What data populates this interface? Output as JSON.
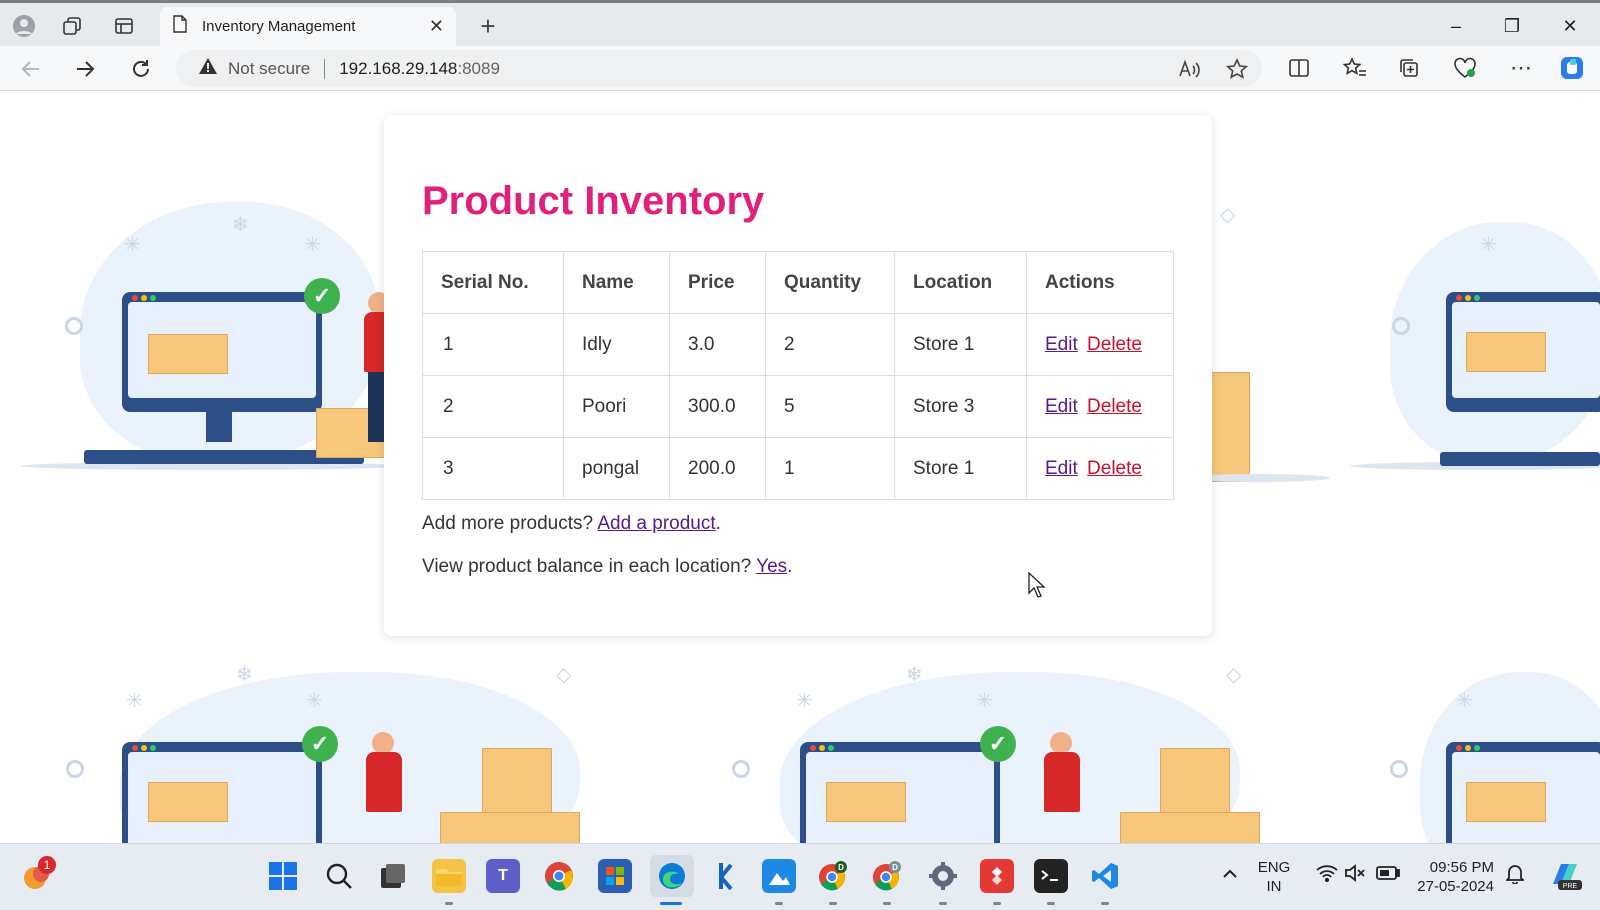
{
  "browser": {
    "tab_title": "Inventory Management",
    "tab_close": "✕",
    "new_tab": "+",
    "security_label": "Not secure",
    "url_host": "192.168.29.148",
    "url_port": ":8089",
    "window_controls": {
      "minimize": "–",
      "restore": "❐",
      "close": "✕"
    }
  },
  "page": {
    "heading": "Product Inventory",
    "table": {
      "headers": {
        "serial": "Serial No.",
        "name": "Name",
        "price": "Price",
        "quantity": "Quantity",
        "location": "Location",
        "actions": "Actions"
      },
      "rows": [
        {
          "serial": "1",
          "name": "Idly",
          "price": "3.0",
          "quantity": "2",
          "location": "Store 1",
          "edit": "Edit",
          "delete": "Delete"
        },
        {
          "serial": "2",
          "name": "Poori",
          "price": "300.0",
          "quantity": "5",
          "location": "Store 3",
          "edit": "Edit",
          "delete": "Delete"
        },
        {
          "serial": "3",
          "name": "pongal",
          "price": "200.0",
          "quantity": "1",
          "location": "Store 1",
          "edit": "Edit",
          "delete": "Delete"
        }
      ]
    },
    "add_more_text": "Add more products?",
    "add_link": "Add a product",
    "view_balance_text": "View product balance in each location?",
    "view_link": "Yes",
    "period": "."
  },
  "taskbar": {
    "notification_count": "1",
    "language_line1": "ENG",
    "language_line2": "IN",
    "time": "09:56 PM",
    "date": "27-05-2024"
  },
  "colors": {
    "heading": "#e0207a",
    "link_visited": "#551a8b",
    "delete_link": "#c8102e"
  }
}
